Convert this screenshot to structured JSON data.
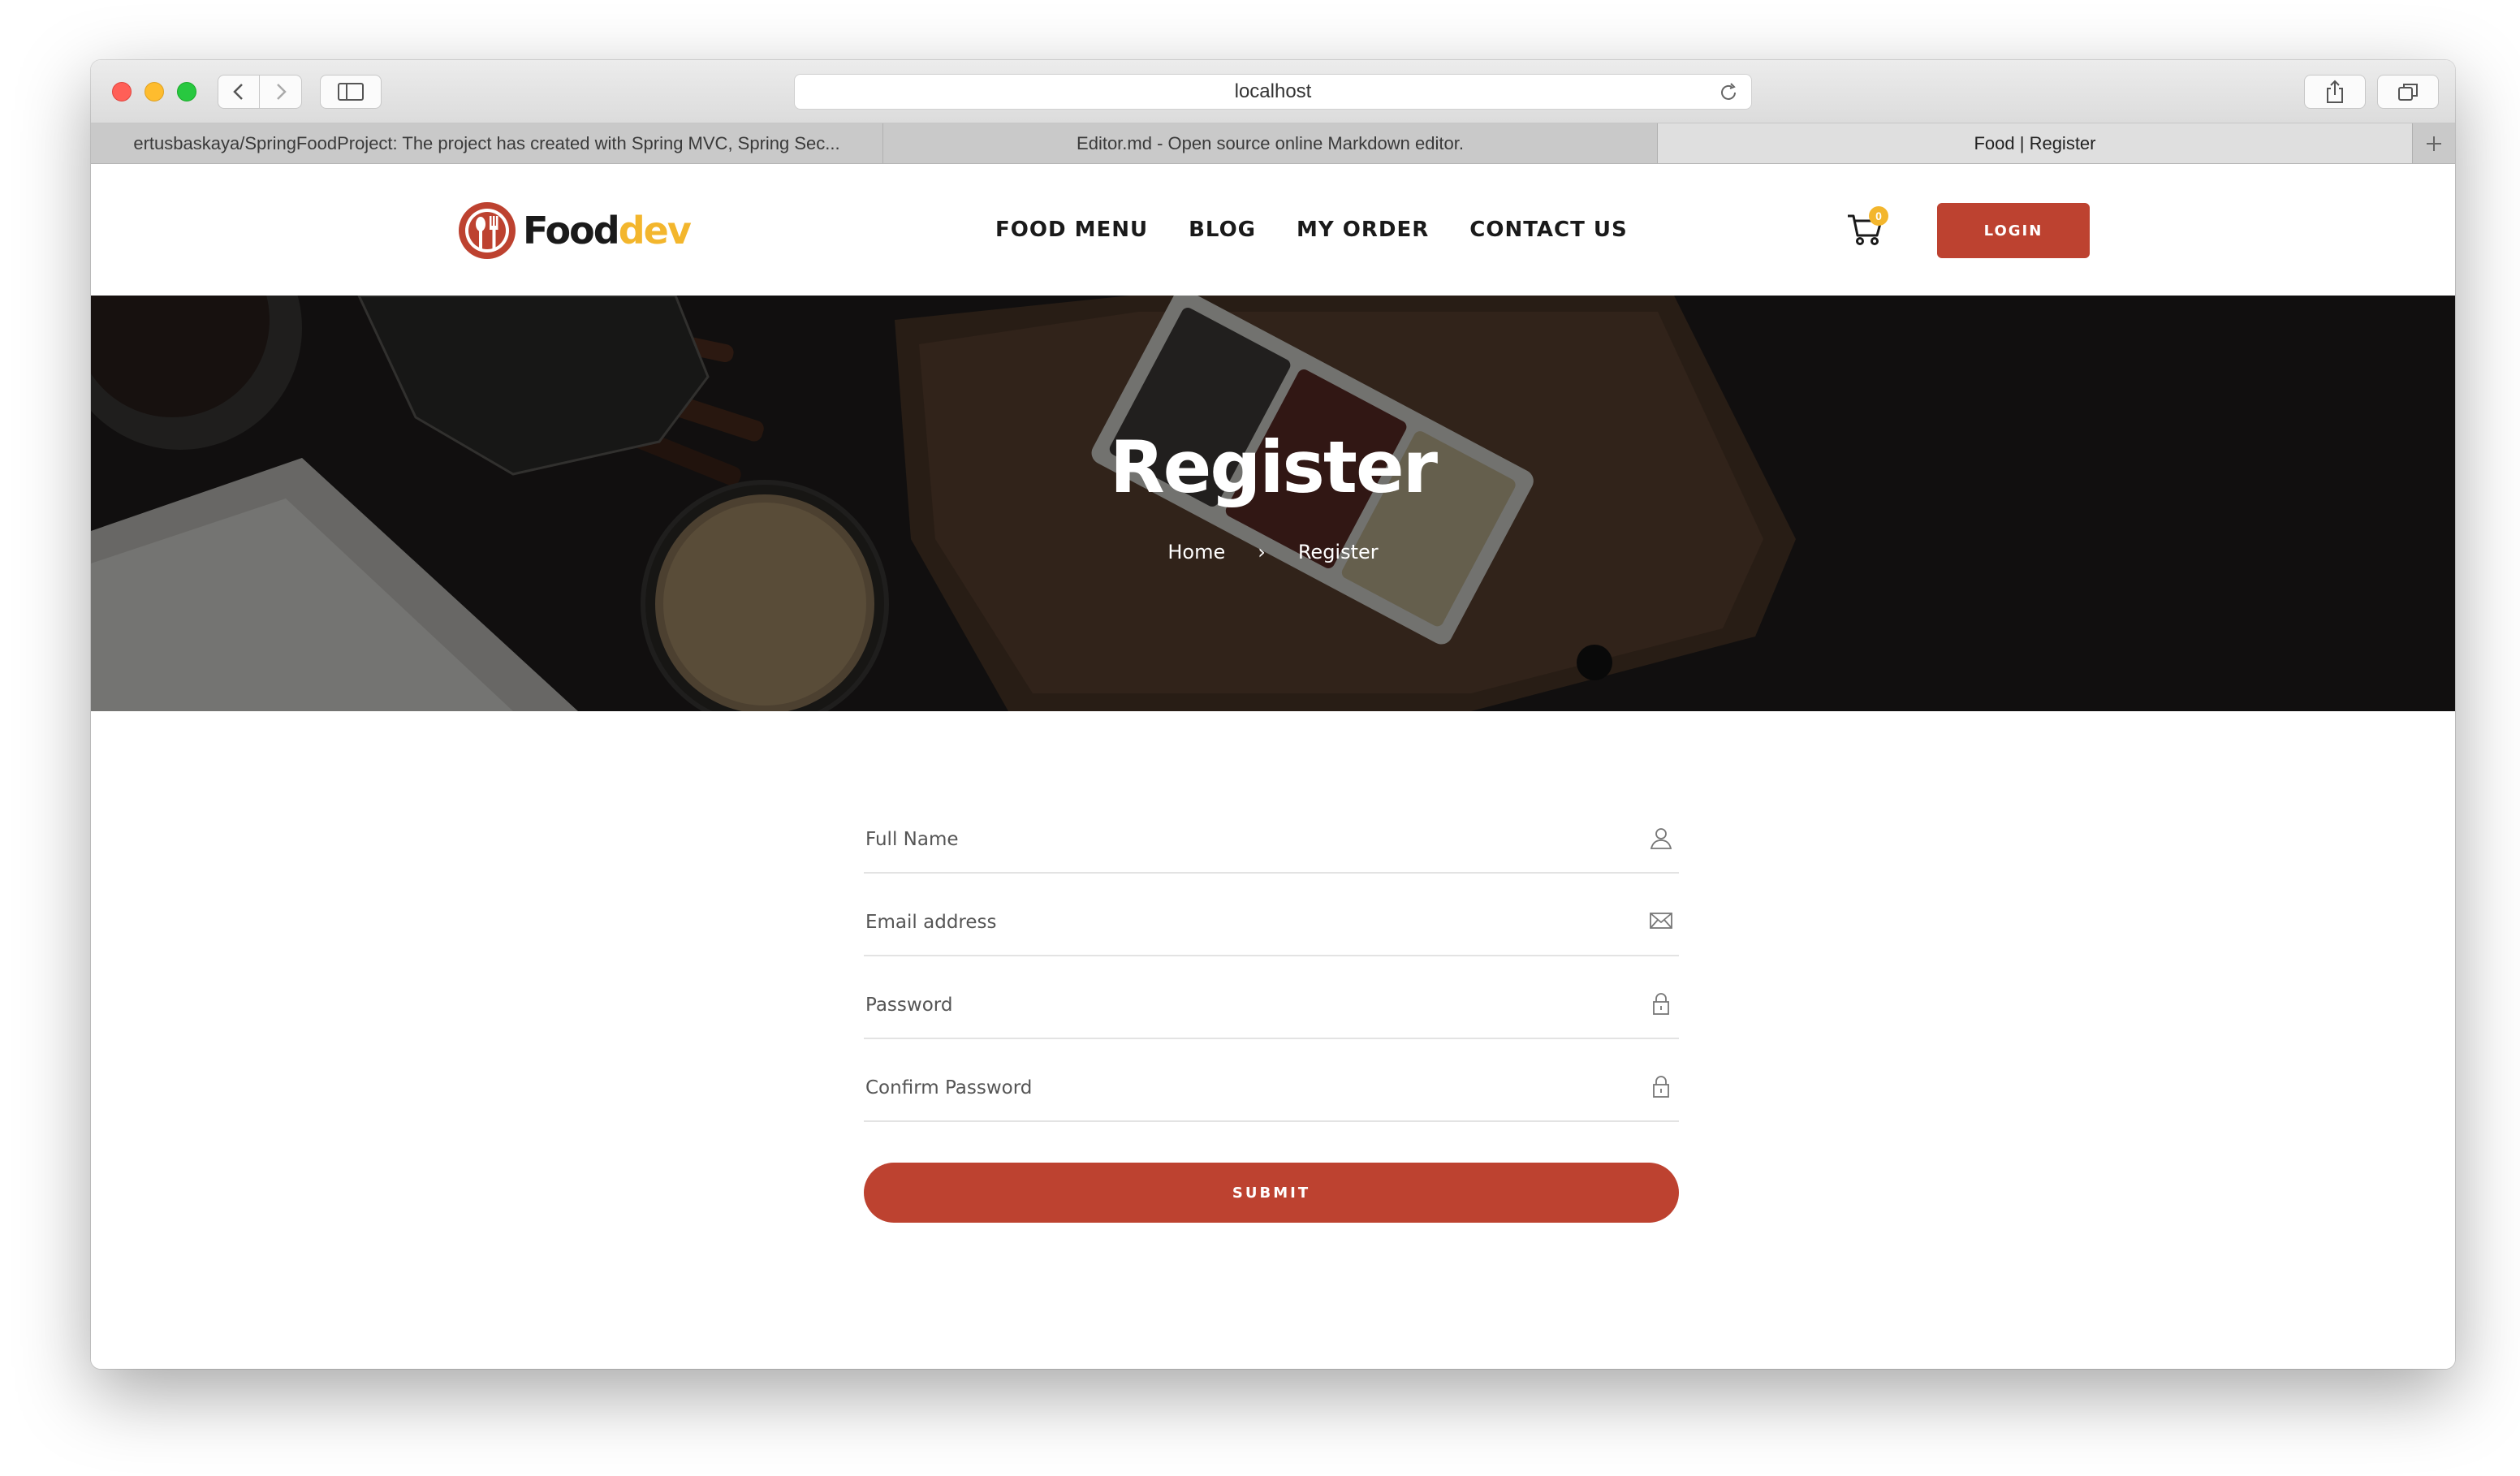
{
  "browser": {
    "url": "localhost",
    "tabs": [
      {
        "label": "ertusbaskaya/SpringFoodProject: The project has created with Spring MVC, Spring Sec..."
      },
      {
        "label": "Editor.md - Open source online Markdown editor."
      },
      {
        "label": "Food | Register"
      }
    ]
  },
  "site": {
    "logo": {
      "part1": "Food",
      "part2": "dev"
    },
    "nav": [
      "FOOD MENU",
      "BLOG",
      "MY ORDER",
      "CONTACT US"
    ],
    "cart_count": "0",
    "login_label": "LOGIN"
  },
  "hero": {
    "title": "Register",
    "breadcrumb": {
      "home": "Home",
      "separator": "›",
      "current": "Register"
    }
  },
  "form": {
    "fields": [
      {
        "placeholder": "Full Name",
        "icon": "user-icon"
      },
      {
        "placeholder": "Email address",
        "icon": "envelope-icon"
      },
      {
        "placeholder": "Password",
        "icon": "lock-icon"
      },
      {
        "placeholder": "Confirm Password",
        "icon": "lock-icon"
      }
    ],
    "submit_label": "SUBMIT"
  },
  "colors": {
    "brand_red": "#bd4230",
    "brand_yellow": "#f3b62d",
    "hero_bg": "#1e1c1b"
  }
}
